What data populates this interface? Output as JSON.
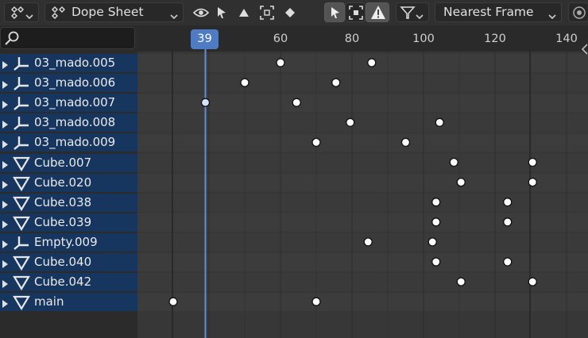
{
  "header": {
    "editor_type_icon": "dope-sheet-editor-icon",
    "mode_label": "Dope Sheet",
    "snap_mode": "Nearest Frame",
    "toolbar_icons": [
      "eye-icon",
      "select-cursor-icon",
      "triangle-icon",
      "select-box-icon",
      "keyframe-diamond-icon"
    ]
  },
  "search": {
    "placeholder": ""
  },
  "timeline": {
    "current_frame": "39",
    "ticks": [
      "60",
      "80",
      "100",
      "120",
      "140"
    ]
  },
  "channels": [
    {
      "label": "03_mado.005",
      "icon": "empty-icon",
      "keys": [
        60,
        85.5
      ]
    },
    {
      "label": "03_mado.006",
      "icon": "empty-icon",
      "keys": [
        50,
        75.5
      ]
    },
    {
      "label": "03_mado.007",
      "icon": "empty-icon",
      "keys": [
        39,
        64.5
      ]
    },
    {
      "label": "03_mado.008",
      "icon": "empty-icon",
      "keys": [
        79.5,
        104.5
      ]
    },
    {
      "label": "03_mado.009",
      "icon": "empty-icon",
      "keys": [
        70,
        95
      ]
    },
    {
      "label": "Cube.007",
      "icon": "mesh-icon",
      "keys": [
        108.5,
        130.5
      ]
    },
    {
      "label": "Cube.020",
      "icon": "mesh-icon",
      "keys": [
        110.5,
        130.5
      ]
    },
    {
      "label": "Cube.038",
      "icon": "mesh-icon",
      "keys": [
        103.5,
        123.5
      ]
    },
    {
      "label": "Cube.039",
      "icon": "mesh-icon",
      "keys": [
        103.5,
        123.5
      ]
    },
    {
      "label": "Empty.009",
      "icon": "empty-icon",
      "keys": [
        84.5,
        102.5
      ]
    },
    {
      "label": "Cube.040",
      "icon": "mesh-icon",
      "keys": [
        103.5,
        123.5
      ]
    },
    {
      "label": "Cube.042",
      "icon": "mesh-icon",
      "keys": [
        110.5,
        130.5
      ]
    },
    {
      "label": "main",
      "icon": "mesh-icon",
      "keys": [
        30,
        70
      ]
    }
  ],
  "colors": {
    "channel_bg": "#17365f",
    "playhead": "#5c8fd6",
    "frame_box": "#4f7bc2",
    "keyframe": "#ffffff",
    "keyframe_selected": "#cfe2ff"
  }
}
